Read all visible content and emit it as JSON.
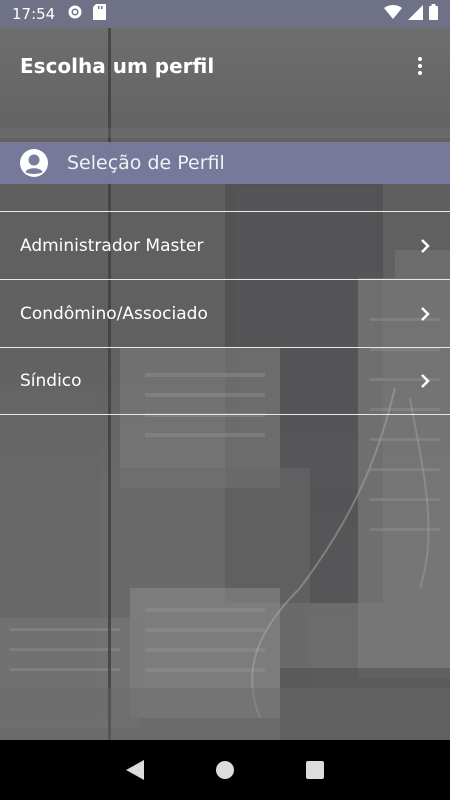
{
  "status_bar": {
    "time": "17:54",
    "left_icons": [
      "gear-icon",
      "sd-card-icon"
    ],
    "right_icons": [
      "wifi-icon",
      "signal-icon",
      "battery-icon"
    ]
  },
  "app_bar": {
    "title": "Escolha um perfil",
    "menu_icon": "more-vertical-icon"
  },
  "section": {
    "title": "Seleção de Perfil",
    "icon": "user-avatar-icon"
  },
  "profiles": [
    {
      "label": "Administrador Master"
    },
    {
      "label": "Condômino/Associado"
    },
    {
      "label": "Síndico"
    }
  ],
  "nav_bar": {
    "buttons": [
      "back-icon",
      "home-icon",
      "recents-icon"
    ]
  },
  "colors": {
    "status_bar": "#6f7186",
    "section_header": "#787c9e",
    "text": "#ffffff",
    "divider": "#e8e8e8"
  }
}
